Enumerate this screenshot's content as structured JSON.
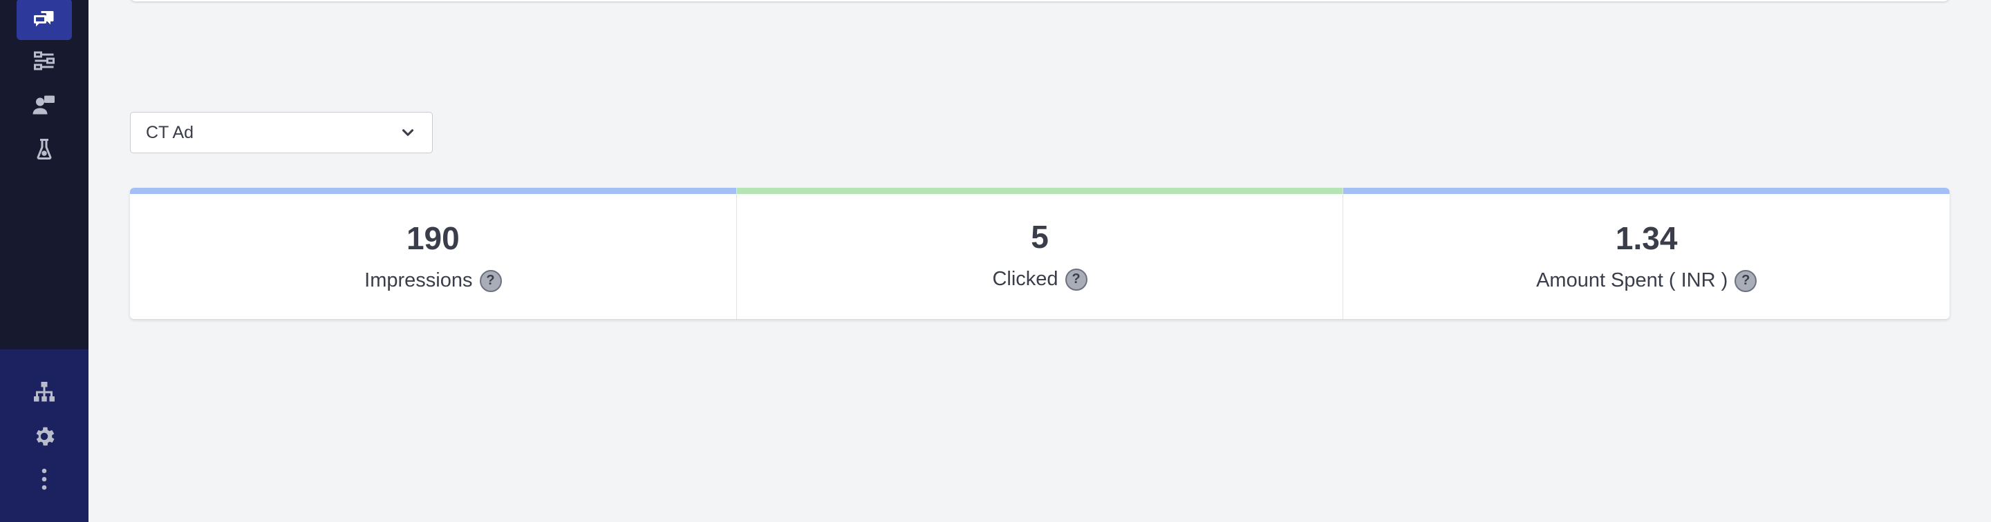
{
  "sidebar": {
    "top_items": [
      {
        "icon": "chat-messages-icon",
        "active": true
      },
      {
        "icon": "flow-icon",
        "active": false
      },
      {
        "icon": "support-agent-icon",
        "active": false
      },
      {
        "icon": "lab-flask-icon",
        "active": false
      }
    ],
    "bottom_items": [
      {
        "icon": "hierarchy-icon"
      },
      {
        "icon": "gear-icon"
      },
      {
        "icon": "more-vertical-icon"
      }
    ]
  },
  "filter": {
    "selected": "CT Ad"
  },
  "stats": [
    {
      "value": "190",
      "label": "Impressions",
      "color": "#a3bff5"
    },
    {
      "value": "5",
      "label": "Clicked",
      "color": "#b4e3b4"
    },
    {
      "value": "1.34",
      "label": "Amount Spent ( INR )",
      "color": "#a3bff5"
    }
  ],
  "help_glyph": "?",
  "colors": {
    "sidebar": "#171a2e",
    "sidebar_bottom": "#1c2260",
    "active_item": "#2d3a9c",
    "background": "#f3f4f6"
  }
}
